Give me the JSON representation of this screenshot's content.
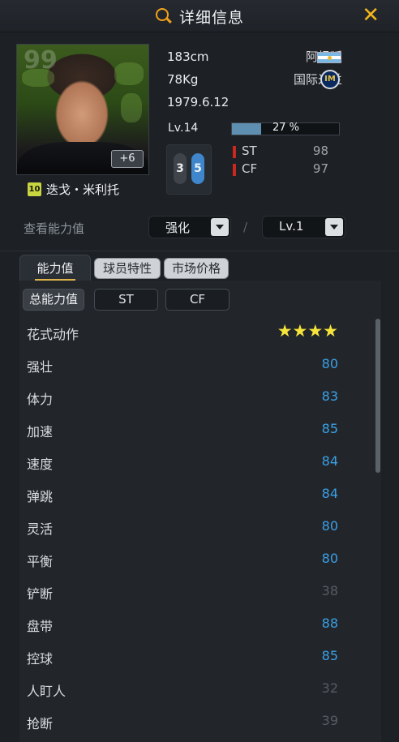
{
  "header": {
    "title": "详细信息",
    "close_symbol": "✕"
  },
  "player": {
    "name": "迭戈・米利托",
    "season_badge": "10",
    "rating_watermark": "99",
    "plus_badge": "+6",
    "height": "183cm",
    "weight": "78Kg",
    "birthdate": "1979.6.12",
    "nation": "阿根廷",
    "club": "国际米兰",
    "level": "Lv.14",
    "progress_text": "27 %",
    "progress_value": 27,
    "foot_left": "3",
    "foot_right": "5",
    "positions": [
      {
        "name": "ST",
        "value": "98"
      },
      {
        "name": "CF",
        "value": "97"
      }
    ]
  },
  "controls": {
    "view_label": "查看能力值",
    "enhance_value": "强化",
    "separator": "/",
    "level_value": "Lv.1"
  },
  "tabs": [
    {
      "label": "能力值",
      "active": true
    },
    {
      "label": "球员特性",
      "active": false
    },
    {
      "label": "市场价格",
      "active": false
    }
  ],
  "segments": [
    {
      "label": "总能力值",
      "active": true
    },
    {
      "label": "ST",
      "active": false
    },
    {
      "label": "CF",
      "active": false
    }
  ],
  "stats": [
    {
      "label": "花式动作",
      "value": "★★★★",
      "kind": "stars"
    },
    {
      "label": "强壮",
      "value": "80",
      "kind": "high"
    },
    {
      "label": "体力",
      "value": "83",
      "kind": "high"
    },
    {
      "label": "加速",
      "value": "85",
      "kind": "high"
    },
    {
      "label": "速度",
      "value": "84",
      "kind": "high"
    },
    {
      "label": "弹跳",
      "value": "84",
      "kind": "high"
    },
    {
      "label": "灵活",
      "value": "80",
      "kind": "high"
    },
    {
      "label": "平衡",
      "value": "80",
      "kind": "high"
    },
    {
      "label": "铲断",
      "value": "38",
      "kind": "low"
    },
    {
      "label": "盘带",
      "value": "88",
      "kind": "high"
    },
    {
      "label": "控球",
      "value": "85",
      "kind": "high"
    },
    {
      "label": "人盯人",
      "value": "32",
      "kind": "low"
    },
    {
      "label": "抢断",
      "value": "39",
      "kind": "low"
    }
  ],
  "colors": {
    "accent": "#f2b41c",
    "stat_high": "#3aa0e6",
    "stat_low": "#565c63",
    "star": "#f6e43a"
  }
}
